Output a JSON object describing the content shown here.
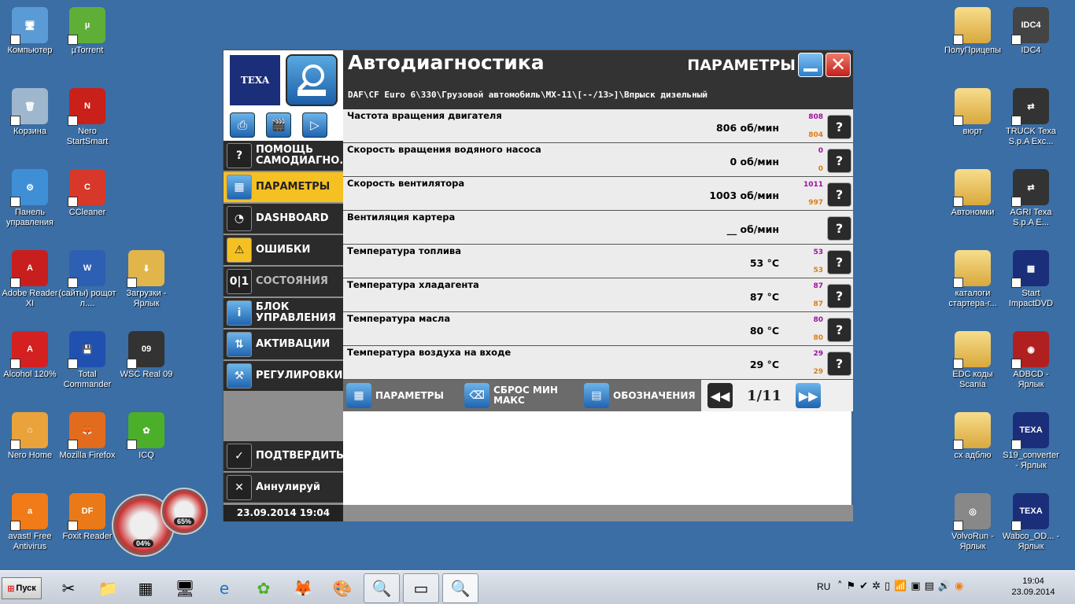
{
  "desktop": {
    "icons_left": [
      {
        "label": "Компьютер",
        "icon": "computer-icon",
        "color": "#5b9bd5",
        "glyph": "🖥"
      },
      {
        "label": "µTorrent",
        "icon": "utorrent-icon",
        "color": "#5fae38",
        "glyph": "µ"
      },
      {
        "label": "Корзина",
        "icon": "recycle-bin-icon",
        "color": "#9fb7cc",
        "glyph": "🗑"
      },
      {
        "label": "Nero StartSmart",
        "icon": "nero-icon",
        "color": "#c9201a",
        "glyph": "N"
      },
      {
        "label": "Панель управления",
        "icon": "control-panel-icon",
        "color": "#3f8fd6",
        "glyph": "⚙"
      },
      {
        "label": "CCleaner",
        "icon": "ccleaner-icon",
        "color": "#d8382a",
        "glyph": "C"
      },
      {
        "label": "Adobe Reader XI",
        "icon": "adobe-reader-icon",
        "color": "#c81e1e",
        "glyph": "A"
      },
      {
        "label": "(сайты) рощот л....",
        "icon": "word-doc-icon",
        "color": "#2d5fb3",
        "glyph": "W"
      },
      {
        "label": "Загрузки - Ярлык",
        "icon": "downloads-folder-icon",
        "color": "#e2b54a",
        "glyph": "⬇"
      },
      {
        "label": "Alcohol 120%",
        "icon": "alcohol-icon",
        "color": "#d42020",
        "glyph": "A"
      },
      {
        "label": "Total Commander",
        "icon": "total-commander-icon",
        "color": "#2050b0",
        "glyph": "💾"
      },
      {
        "label": "WSC Real 09",
        "icon": "wsc-real-icon",
        "color": "#333333",
        "glyph": "09"
      },
      {
        "label": "Nero Home",
        "icon": "nero-home-icon",
        "color": "#e9a33a",
        "glyph": "⌂"
      },
      {
        "label": "Mozilla Firefox",
        "icon": "firefox-icon",
        "color": "#e26b1d",
        "glyph": "🦊"
      },
      {
        "label": "ICQ",
        "icon": "icq-icon",
        "color": "#4caf2a",
        "glyph": "✿"
      },
      {
        "label": "avast! Free Antivirus",
        "icon": "avast-icon",
        "color": "#f07b18",
        "glyph": "a"
      },
      {
        "label": "Foxit Reader",
        "icon": "foxit-icon",
        "color": "#ea7a18",
        "glyph": "DF"
      }
    ],
    "icons_right": [
      {
        "label": "ПолуПрицепы",
        "icon": "folder-icon",
        "folder": true
      },
      {
        "label": "IDC4",
        "icon": "idc4-icon",
        "color": "#444",
        "glyph": "IDC4"
      },
      {
        "label": "вюрт",
        "icon": "folder-icon",
        "folder": true
      },
      {
        "label": "TRUCK Texa S.p.A Exc...",
        "icon": "truck-texa-icon",
        "color": "#333",
        "glyph": "⇄"
      },
      {
        "label": "Автономки",
        "icon": "folder-icon",
        "folder": true
      },
      {
        "label": "AGRI Texa S.p.A E...",
        "icon": "agri-texa-icon",
        "color": "#333",
        "glyph": "⇄"
      },
      {
        "label": "каталоги стартера-г...",
        "icon": "folder-icon",
        "folder": true
      },
      {
        "label": "Start ImpactDVD",
        "icon": "impact-dvd-icon",
        "color": "#1b2e7a",
        "glyph": "▦"
      },
      {
        "label": "EDC коды Scania",
        "icon": "folder-icon",
        "folder": true
      },
      {
        "label": "ADBCD - Ярлык",
        "icon": "adbcd-icon",
        "color": "#b02020",
        "glyph": "◉"
      },
      {
        "label": "сх адблю",
        "icon": "folder-icon",
        "folder": true
      },
      {
        "label": "S19_converter - Ярлык",
        "icon": "texa-s19-icon",
        "color": "#1b2e7a",
        "glyph": "TEXA"
      },
      {
        "label": "VolvoRun - Ярлык",
        "icon": "volvorun-icon",
        "color": "#888",
        "glyph": "◎"
      },
      {
        "label": "Wabco_OD... - Ярлык",
        "icon": "texa-wabco-icon",
        "color": "#1b2e7a",
        "glyph": "TEXA"
      }
    ],
    "gadget": {
      "cpu": "04%",
      "mem": "65%"
    }
  },
  "app": {
    "logo_text": "TEXA",
    "title": "Автодиагностика",
    "section": "ПАРАМЕТРЫ",
    "breadcrumb": "DAF\\CF Euro 6\\330\\Грузовой автомобиль\\MX-11\\[--/13>]\\Впрыск дизельный",
    "sidebar": {
      "nav": [
        {
          "label": "ПОМОЩЬ САМОДИАГНО...",
          "icon": "help-icon",
          "glyph": "?",
          "active": false,
          "dim": false
        },
        {
          "label": "ПАРАМЕТРЫ",
          "icon": "grid-icon",
          "glyph": "▦",
          "active": true,
          "dim": false
        },
        {
          "label": "DASHBOARD",
          "icon": "dashboard-icon",
          "glyph": "◔",
          "active": false,
          "dim": false
        },
        {
          "label": "ОШИБКИ",
          "icon": "warning-icon",
          "glyph": "⚠",
          "active": false,
          "dim": false
        },
        {
          "label": "СОСТОЯНИЯ",
          "icon": "state-icon",
          "glyph": "0|1",
          "active": false,
          "dim": true
        },
        {
          "label": "БЛОК УПРАВЛЕНИЯ",
          "icon": "info-icon",
          "glyph": "i",
          "active": false,
          "dim": false
        },
        {
          "label": "АКТИВАЦИИ",
          "icon": "activation-icon",
          "glyph": "⇅",
          "active": false,
          "dim": false
        },
        {
          "label": "РЕГУЛИРОВКИ",
          "icon": "adjust-icon",
          "glyph": "⚒",
          "active": false,
          "dim": false
        }
      ],
      "confirm": "ПОДТВЕРДИТЬ",
      "cancel": "Аннулируй",
      "datetime": "23.09.2014  19:04"
    },
    "parameters": [
      {
        "name": "Частота вращения двигателя",
        "value": "806 об/мин",
        "max": "808",
        "min": "804"
      },
      {
        "name": "Скорость вращения водяного насоса",
        "value": "0 об/мин",
        "max": "0",
        "min": "0"
      },
      {
        "name": "Скорость вентилятора",
        "value": "1003 об/мин",
        "max": "1011",
        "min": "997"
      },
      {
        "name": "Вентиляция картера",
        "value": "__ об/мин",
        "max": "",
        "min": ""
      },
      {
        "name": "Температура топлива",
        "value": "53 °C",
        "max": "53",
        "min": "53"
      },
      {
        "name": "Температура хладагента",
        "value": "87 °C",
        "max": "87",
        "min": "87"
      },
      {
        "name": "Температура масла",
        "value": "80 °C",
        "max": "80",
        "min": "80"
      },
      {
        "name": "Температура воздуха на входе",
        "value": "29 °C",
        "max": "29",
        "min": "29"
      }
    ],
    "bottom": {
      "params_label": "ПАРАМЕТРЫ",
      "reset_label": "СБРОС МИН МАКС",
      "legend_label": "ОБОЗНАЧЕНИЯ",
      "page": "1/11"
    }
  },
  "taskbar": {
    "start": "Пуск",
    "lang": "RU",
    "time": "19:04",
    "date": "23.09.2014"
  },
  "colors": {
    "accent": "#f5c022",
    "header": "#333333",
    "desktop": "#3a6ea5",
    "max": "#a010a0",
    "min": "#e07d10"
  }
}
